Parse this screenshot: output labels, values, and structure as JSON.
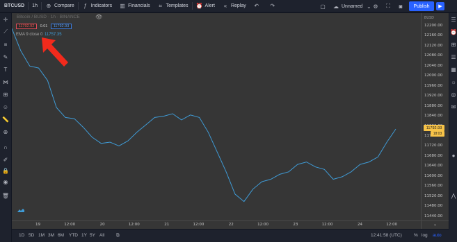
{
  "toolbar": {
    "symbol": "BTCUSD",
    "interval": "1h",
    "compare": "Compare",
    "indicators": "Indicators",
    "financials": "Financials",
    "templates": "Templates",
    "alert": "Alert",
    "replay": "Replay",
    "layout_name": "Unnamed",
    "publish": "Publish"
  },
  "legend": {
    "title": "Bitcoin / BUSD · 1h · BINANCE",
    "bid": "11792.92",
    "spread": "0.01",
    "ask": "11792.93",
    "ema_label": "EMA 9 close 0",
    "ema_value": "11757.35"
  },
  "price_axis": {
    "currency": "BUSD",
    "ticks": [
      "12200.00",
      "12160.00",
      "12120.00",
      "12080.00",
      "12040.00",
      "12000.00",
      "11960.00",
      "11920.00",
      "11880.00",
      "11840.00",
      "11800.00",
      "11760.00",
      "11720.00",
      "11680.00",
      "11640.00",
      "11600.00",
      "11560.00",
      "11520.00",
      "11480.00",
      "11440.00"
    ],
    "last_price": "11792.93",
    "countdown": "18:03"
  },
  "time_axis": {
    "ticks": [
      "19",
      "12:00",
      "20",
      "12:00",
      "21",
      "12:00",
      "22",
      "12:00",
      "23",
      "12:00",
      "24",
      "12:00"
    ]
  },
  "bottom": {
    "ranges": [
      "1D",
      "5D",
      "1M",
      "3M",
      "6M",
      "YTD",
      "1Y",
      "5Y",
      "All"
    ],
    "clock": "12:41:58 (UTC)",
    "percent": "%",
    "log": "log",
    "auto": "auto"
  },
  "colors": {
    "ema_line": "#3f9bd6",
    "last_price_bg": "#f7c348",
    "accent": "#2962ff"
  },
  "chart_data": {
    "type": "line",
    "series": [
      {
        "name": "EMA 9 close 0",
        "x": [
          "19 00:00",
          "19 03:00",
          "19 06:00",
          "19 09:00",
          "19 12:00",
          "19 15:00",
          "19 18:00",
          "19 21:00",
          "20 00:00",
          "20 03:00",
          "20 06:00",
          "20 09:00",
          "20 12:00",
          "20 15:00",
          "20 18:00",
          "20 21:00",
          "21 00:00",
          "21 03:00",
          "21 06:00",
          "21 09:00",
          "21 12:00",
          "21 15:00",
          "21 18:00",
          "21 21:00",
          "22 00:00",
          "22 03:00",
          "22 06:00",
          "22 09:00",
          "22 12:00",
          "22 15:00",
          "22 18:00",
          "22 21:00",
          "23 00:00",
          "23 03:00",
          "23 06:00",
          "23 09:00",
          "23 12:00",
          "23 15:00",
          "23 18:00",
          "23 21:00",
          "24 00:00",
          "24 03:00",
          "24 06:00",
          "24 09:00"
        ],
        "values": [
          12200,
          12110,
          12048,
          12040,
          11990,
          11880,
          11840,
          11835,
          11800,
          11760,
          11735,
          11740,
          11725,
          11745,
          11780,
          11810,
          11840,
          11845,
          11855,
          11830,
          11850,
          11840,
          11780,
          11700,
          11620,
          11530,
          11500,
          11550,
          11580,
          11590,
          11610,
          11620,
          11650,
          11660,
          11640,
          11630,
          11590,
          11600,
          11620,
          11650,
          11660,
          11680,
          11740,
          11793
        ]
      }
    ],
    "ylim": [
      11420,
      12230
    ],
    "grid": false
  }
}
